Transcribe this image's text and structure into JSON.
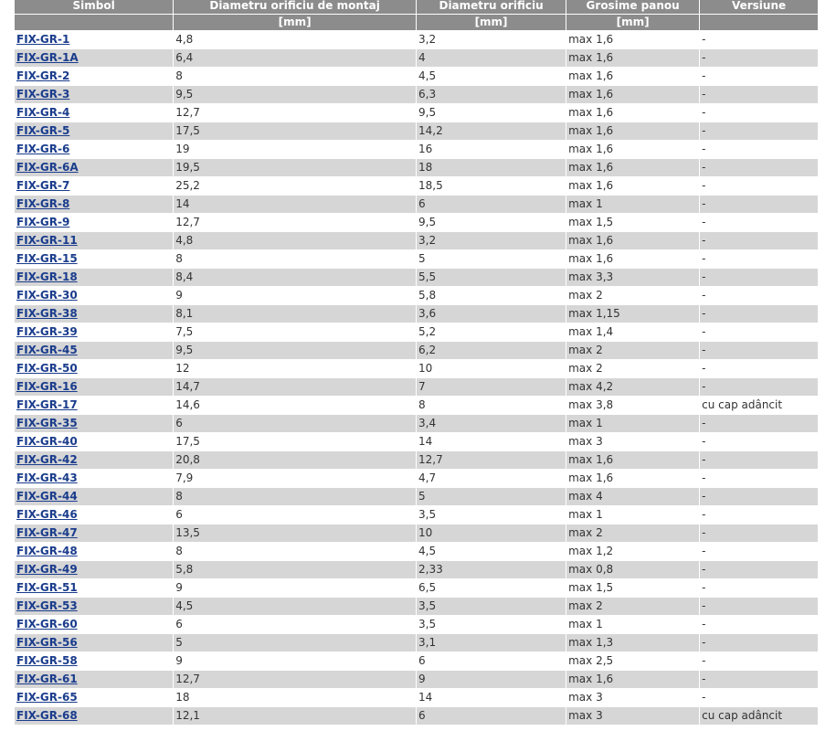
{
  "table": {
    "headers": [
      "Simbol",
      "Diametru orificiu de montaj",
      "Diametru orificiu",
      "Grosime panou",
      "Versiune"
    ],
    "units": [
      "",
      "[mm]",
      "[mm]",
      "[mm]",
      ""
    ],
    "rows": [
      [
        "FIX-GR-1",
        "4,8",
        "3,2",
        "max 1,6",
        "-"
      ],
      [
        "FIX-GR-1A",
        "6,4",
        "4",
        "max 1,6",
        "-"
      ],
      [
        "FIX-GR-2",
        "8",
        "4,5",
        "max 1,6",
        "-"
      ],
      [
        "FIX-GR-3",
        "9,5",
        "6,3",
        "max 1,6",
        "-"
      ],
      [
        "FIX-GR-4",
        "12,7",
        "9,5",
        "max 1,6",
        "-"
      ],
      [
        "FIX-GR-5",
        "17,5",
        "14,2",
        "max 1,6",
        "-"
      ],
      [
        "FIX-GR-6",
        "19",
        "16",
        "max 1,6",
        "-"
      ],
      [
        "FIX-GR-6A",
        "19,5",
        "18",
        "max 1,6",
        "-"
      ],
      [
        "FIX-GR-7",
        "25,2",
        "18,5",
        "max 1,6",
        "-"
      ],
      [
        "FIX-GR-8",
        "14",
        "6",
        "max 1",
        "-"
      ],
      [
        "FIX-GR-9",
        "12,7",
        "9,5",
        "max 1,5",
        "-"
      ],
      [
        "FIX-GR-11",
        "4,8",
        "3,2",
        "max 1,6",
        "-"
      ],
      [
        "FIX-GR-15",
        "8",
        "5",
        "max 1,6",
        "-"
      ],
      [
        "FIX-GR-18",
        "8,4",
        "5,5",
        "max 3,3",
        "-"
      ],
      [
        "FIX-GR-30",
        "9",
        "5,8",
        "max 2",
        "-"
      ],
      [
        "FIX-GR-38",
        "8,1",
        "3,6",
        "max 1,15",
        "-"
      ],
      [
        "FIX-GR-39",
        "7,5",
        "5,2",
        "max 1,4",
        "-"
      ],
      [
        "FIX-GR-45",
        "9,5",
        "6,2",
        "max 2",
        "-"
      ],
      [
        "FIX-GR-50",
        "12",
        "10",
        "max 2",
        "-"
      ],
      [
        "FIX-GR-16",
        "14,7",
        "7",
        "max 4,2",
        "-"
      ],
      [
        "FIX-GR-17",
        "14,6",
        "8",
        "max 3,8",
        "cu cap adâncit"
      ],
      [
        "FIX-GR-35",
        "6",
        "3,4",
        "max 1",
        "-"
      ],
      [
        "FIX-GR-40",
        "17,5",
        "14",
        "max 3",
        "-"
      ],
      [
        "FIX-GR-42",
        "20,8",
        "12,7",
        "max 1,6",
        "-"
      ],
      [
        "FIX-GR-43",
        "7,9",
        "4,7",
        "max 1,6",
        "-"
      ],
      [
        "FIX-GR-44",
        "8",
        "5",
        "max 4",
        "-"
      ],
      [
        "FIX-GR-46",
        "6",
        "3,5",
        "max 1",
        "-"
      ],
      [
        "FIX-GR-47",
        "13,5",
        "10",
        "max 2",
        "-"
      ],
      [
        "FIX-GR-48",
        "8",
        "4,5",
        "max 1,2",
        "-"
      ],
      [
        "FIX-GR-49",
        "5,8",
        "2,33",
        "max 0,8",
        "-"
      ],
      [
        "FIX-GR-51",
        "9",
        "6,5",
        "max 1,5",
        "-"
      ],
      [
        "FIX-GR-53",
        "4,5",
        "3,5",
        "max 2",
        "-"
      ],
      [
        "FIX-GR-60",
        "6",
        "3,5",
        "max 1",
        "-"
      ],
      [
        "FIX-GR-56",
        "5",
        "3,1",
        "max 1,3",
        "-"
      ],
      [
        "FIX-GR-58",
        "9",
        "6",
        "max 2,5",
        "-"
      ],
      [
        "FIX-GR-61",
        "12,7",
        "9",
        "max 1,6",
        "-"
      ],
      [
        "FIX-GR-65",
        "18",
        "14",
        "max 3",
        "-"
      ],
      [
        "FIX-GR-68",
        "12,1",
        "6",
        "max 3",
        "cu cap adâncit"
      ]
    ]
  }
}
